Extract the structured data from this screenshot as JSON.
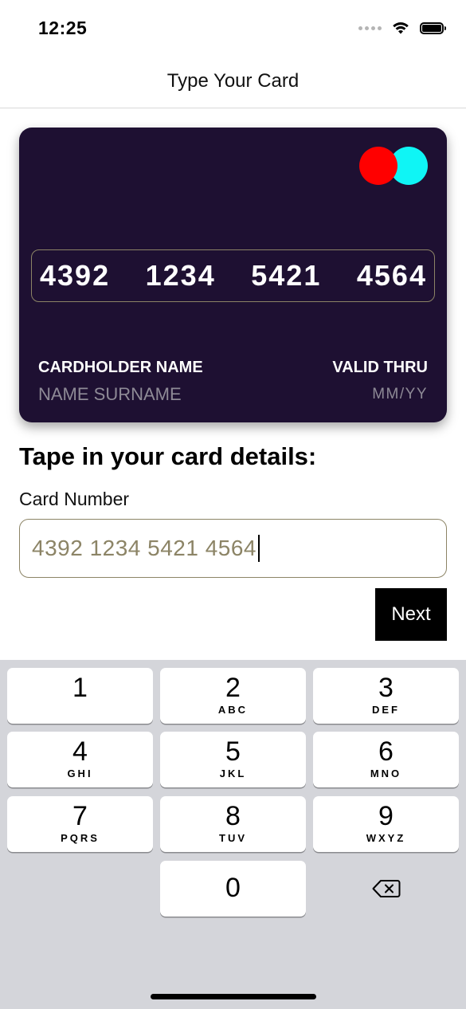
{
  "status_bar": {
    "time": "12:25"
  },
  "nav": {
    "title": "Type Your Card"
  },
  "card": {
    "number_groups": [
      "4392",
      "1234",
      "5421",
      "4564"
    ],
    "holder_label": "CARDHOLDER NAME",
    "holder_value": "NAME SURNAME",
    "valid_label": "VALID THRU",
    "valid_value": "MM/YY",
    "logo_colors": [
      "#ff0000",
      "#0ff5f5"
    ],
    "background_color": "#1e1032"
  },
  "form": {
    "heading": "Tape in your card details:",
    "field_label": "Card Number",
    "field_value": "4392 1234 5421 4564",
    "next_label": "Next"
  },
  "keyboard": {
    "keys": [
      {
        "digit": "1",
        "letters": ""
      },
      {
        "digit": "2",
        "letters": "ABC"
      },
      {
        "digit": "3",
        "letters": "DEF"
      },
      {
        "digit": "4",
        "letters": "GHI"
      },
      {
        "digit": "5",
        "letters": "JKL"
      },
      {
        "digit": "6",
        "letters": "MNO"
      },
      {
        "digit": "7",
        "letters": "PQRS"
      },
      {
        "digit": "8",
        "letters": "TUV"
      },
      {
        "digit": "9",
        "letters": "WXYZ"
      }
    ],
    "zero": "0",
    "delete_icon": "delete-backward-icon"
  }
}
